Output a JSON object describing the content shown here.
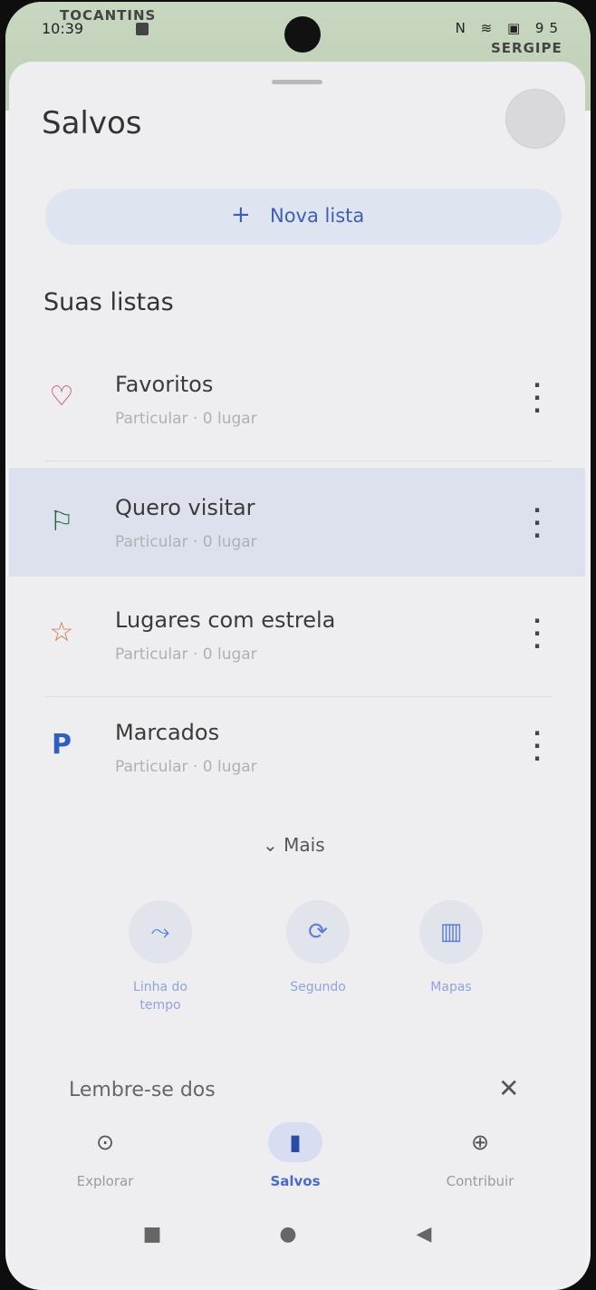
{
  "map": {
    "label_top": "TOCANTINS",
    "label_right": "SERGIPE"
  },
  "status_bar": {
    "time": "10:39",
    "icons": "N ≋ ▣ 95"
  },
  "page": {
    "title": "Salvos"
  },
  "actions": {
    "new_list": "Nova lista",
    "new_list_icon": "plus-icon"
  },
  "section": {
    "your_lists": "Suas listas"
  },
  "lists": [
    {
      "name": "Favoritos",
      "subtitle": "Particular · 0 lugar",
      "icon": "heart-icon",
      "color": "#c0395a"
    },
    {
      "name": "Quero visitar",
      "subtitle": "Particular · 0 lugar",
      "icon": "flag-icon",
      "color": "#1d6b3a"
    },
    {
      "name": "Lugares com estrela",
      "subtitle": "Particular · 0 lugar",
      "icon": "star-icon",
      "color": "#d9734a"
    },
    {
      "name": "Marcados",
      "subtitle": "Particular · 0 lugar",
      "icon": "parking-icon",
      "color": "#2f5fc0"
    }
  ],
  "more": {
    "label": "Mais"
  },
  "tiles": [
    {
      "label_line1": "Linha do",
      "label_line2": "tempo",
      "icon": "timeline-icon"
    },
    {
      "label_line1": "Segundo",
      "label_line2": "",
      "icon": "sync-icon"
    },
    {
      "label_line1": "Mapas",
      "label_line2": "",
      "icon": "map-icon"
    }
  ],
  "reminder": {
    "text": "Lembre-se dos"
  },
  "bottom_nav": [
    {
      "label": "Explorar",
      "icon": "location-pin-icon"
    },
    {
      "label": "Salvos",
      "icon": "bookmark-icon"
    },
    {
      "label": "Contribuir",
      "icon": "add-circle-icon"
    }
  ],
  "colors": {
    "accent": "#3f5fb5",
    "sheet": "#eeeef0"
  }
}
